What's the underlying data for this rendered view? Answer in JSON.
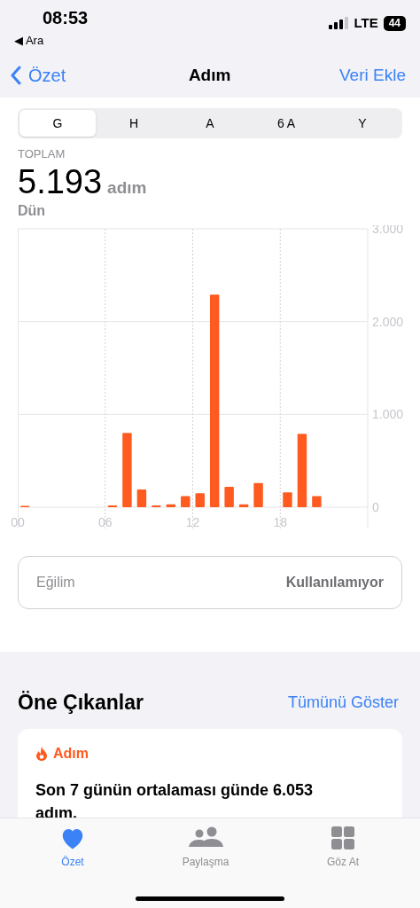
{
  "status_bar": {
    "time": "08:53",
    "back_app": "◀ Ara",
    "network": "LTE",
    "battery": "44"
  },
  "nav": {
    "back": "Özet",
    "title": "Adım",
    "action": "Veri Ekle"
  },
  "range_tabs": [
    {
      "label": "G",
      "selected": true
    },
    {
      "label": "H",
      "selected": false
    },
    {
      "label": "A",
      "selected": false
    },
    {
      "label": "6 A",
      "selected": false
    },
    {
      "label": "Y",
      "selected": false
    }
  ],
  "summary": {
    "label": "TOPLAM",
    "value": "5.193",
    "unit": "adım",
    "date": "Dün"
  },
  "chart_data": {
    "type": "bar",
    "x": [
      0.5,
      6.5,
      7.5,
      8.5,
      9.5,
      10.5,
      11.5,
      12.5,
      13.5,
      14.5,
      15.5,
      16.5,
      18.5,
      19.5,
      20.5
    ],
    "series": [
      {
        "color": "#ff5a1f",
        "values": [
          10,
          20,
          800,
          190,
          20,
          30,
          120,
          150,
          2290,
          220,
          30,
          260,
          160,
          790,
          120
        ]
      }
    ],
    "grid": true,
    "xlim": [
      0,
      24
    ],
    "ylim": [
      0,
      3000
    ],
    "yticks": [
      {
        "value": 0,
        "label": "0"
      },
      {
        "value": 1000,
        "label": "1.000"
      },
      {
        "value": 2000,
        "label": "2.000"
      },
      {
        "value": 3000,
        "label": "3.000"
      }
    ],
    "xticks": [
      {
        "value": 0,
        "label": "00"
      },
      {
        "value": 6,
        "label": "06"
      },
      {
        "value": 12,
        "label": "12"
      },
      {
        "value": 18,
        "label": "18"
      }
    ]
  },
  "trend": {
    "label": "Eğilim",
    "value": "Kullanılamıyor"
  },
  "highlights": {
    "title": "Öne Çıkanlar",
    "action": "Tümünü Göster",
    "card": {
      "category": "Adım",
      "text": "Son 7 günün ortalaması günde 6.053 adım."
    }
  },
  "tab_bar": [
    {
      "kind": "heart",
      "label": "Özet",
      "selected": true
    },
    {
      "kind": "people",
      "label": "Paylaşma",
      "selected": false
    },
    {
      "kind": "grid",
      "label": "Göz At",
      "selected": false
    }
  ]
}
